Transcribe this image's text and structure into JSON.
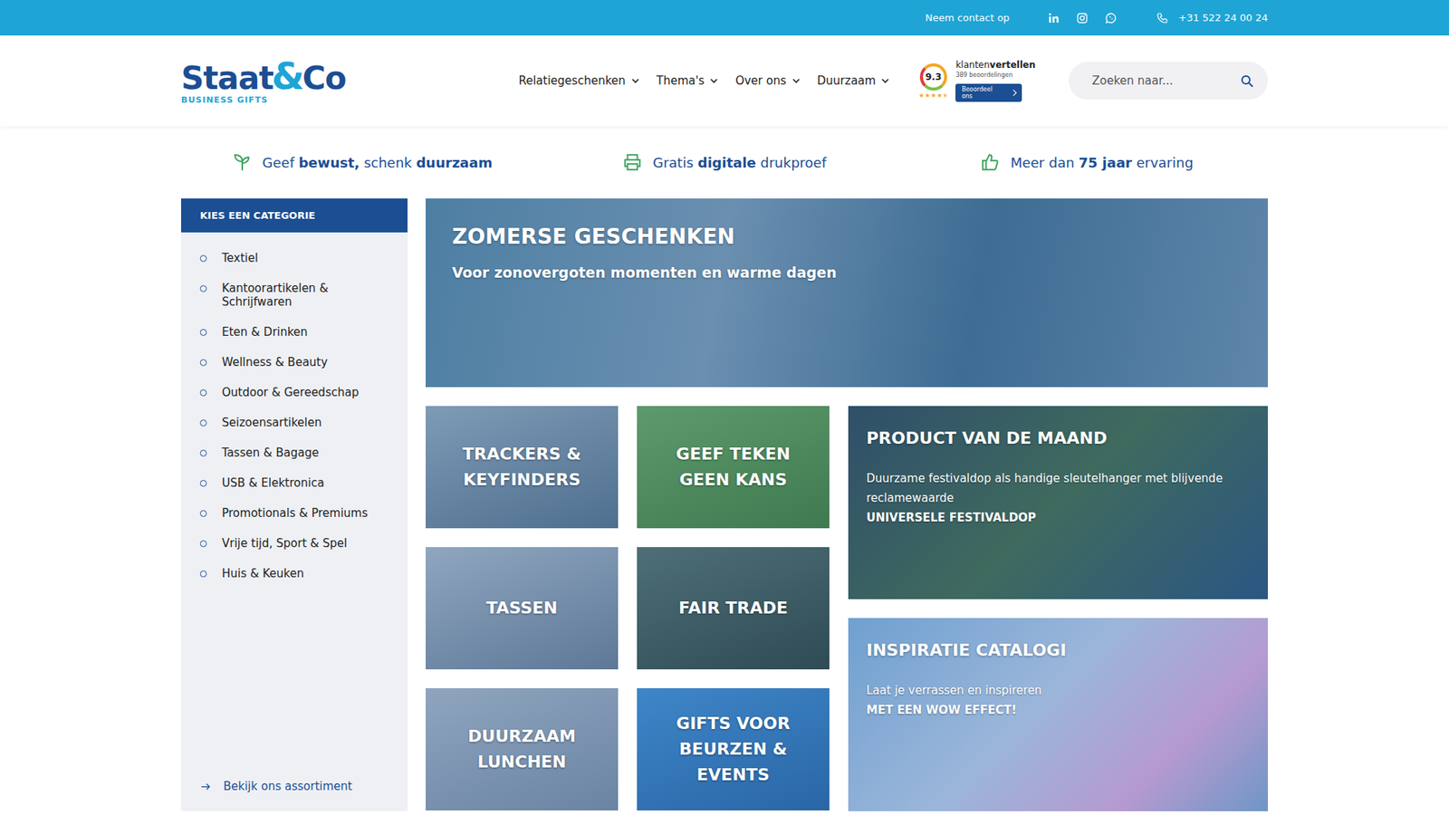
{
  "topbar": {
    "contact": "Neem contact op",
    "phone": "+31 522 24 00 24"
  },
  "logo": {
    "main": "Staat",
    "amp": "&",
    "co": "Co",
    "sub": "BUSINESS GIFTS"
  },
  "nav": [
    {
      "label": "Relatiegeschenken",
      "expanded": false
    },
    {
      "label": "Thema's",
      "expanded": false
    },
    {
      "label": "Over ons",
      "expanded": false
    },
    {
      "label": "Duurzaam",
      "expanded": false
    }
  ],
  "rating": {
    "score": "9.3",
    "brand": [
      "klanten",
      "vertellen"
    ],
    "count": "389 beoordelingen",
    "button": "Beoordeel ons",
    "stars": 4.5
  },
  "search": {
    "placeholder": "Zoeken naar..."
  },
  "usps": [
    {
      "icon": "sprout",
      "parts": [
        {
          "t": "Geef ",
          "b": false
        },
        {
          "t": "bewust,",
          "b": true
        },
        {
          "t": " schenk ",
          "b": false
        },
        {
          "t": "duurzaam",
          "b": true
        }
      ]
    },
    {
      "icon": "printer",
      "parts": [
        {
          "t": "Gratis ",
          "b": false
        },
        {
          "t": "digitale",
          "b": true
        },
        {
          "t": " drukproef",
          "b": false
        }
      ]
    },
    {
      "icon": "thumb",
      "parts": [
        {
          "t": "Meer dan ",
          "b": false
        },
        {
          "t": "75 jaar",
          "b": true
        },
        {
          "t": " ervaring",
          "b": false
        }
      ]
    }
  ],
  "sidebar": {
    "title": "KIES EEN CATEGORIE",
    "items": [
      "Textiel",
      "Kantoorartikelen & Schrijfwaren",
      "Eten & Drinken",
      "Wellness & Beauty",
      "Outdoor & Gereedschap",
      "Seizoensartikelen",
      "Tassen & Bagage",
      "USB & Elektronica",
      "Promotionals & Premiums",
      "Vrije tijd, Sport & Spel",
      "Huis & Keuken"
    ],
    "footer": "Bekijk ons assortiment"
  },
  "hero": {
    "title": "ZOMERSE GESCHENKEN",
    "subtitle": "Voor zonovergoten momenten en warme dagen"
  },
  "tiles": [
    "TRACKERS & KEYFINDERS",
    "GEEF TEKEN GEEN KANS",
    "TASSEN",
    "FAIR TRADE",
    "DUURZAAM LUNCHEN",
    "GIFTS VOOR BEURZEN & EVENTS"
  ],
  "product": {
    "title": "PRODUCT VAN DE MAAND",
    "text": "Duurzame festivaldop als handige sleutelhanger met blijvende reclamewaarde",
    "link": "UNIVERSELE FESTIVALDOP"
  },
  "catalog": {
    "title": "INSPIRATIE CATALOGI",
    "text": "Laat je verrassen en inspireren",
    "link": "MET EEN WOW EFFECT!"
  }
}
